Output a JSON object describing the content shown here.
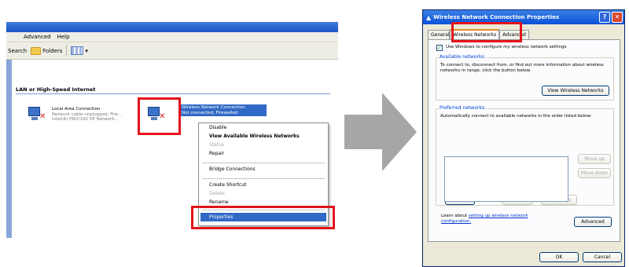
{
  "left_window": {
    "menu": [
      "Advanced",
      "Help"
    ],
    "toolbar": {
      "search": "Search",
      "folders": "Folders",
      "views_caret": "▾"
    },
    "group_header": "LAN or High-Speed Internet",
    "lan": {
      "name": "Local Area Connection",
      "status": "Network cable unplugged, Fire...",
      "device": "Intel(R) PRO/100 VE Network..."
    },
    "wireless": {
      "name": "Wireless Network Connection",
      "status": "Not connected, Firewalled",
      "device": ""
    }
  },
  "context_menu": {
    "items": [
      {
        "label": "Disable",
        "style": ""
      },
      {
        "label": "View Available Wireless Networks",
        "style": "bold"
      },
      {
        "label": "Status",
        "style": "disabled"
      },
      {
        "label": "Repair",
        "style": ""
      },
      {
        "label": "Bridge Connections",
        "style": ""
      },
      {
        "label": "Create Shortcut",
        "style": ""
      },
      {
        "label": "Delete",
        "style": "disabled"
      },
      {
        "label": "Rename",
        "style": ""
      }
    ],
    "selected": "Properties"
  },
  "dialog": {
    "title": "Wireless Network Connection Properties",
    "help": "?",
    "close": "✕",
    "tabs": [
      "General",
      "Wireless Networks",
      "Advanced"
    ],
    "use_windows_label": "Use Windows to configure my wireless network settings",
    "available": {
      "title": "Available networks:",
      "text": "To connect to, disconnect from, or find out more information about wireless networks in range, click the button below.",
      "button": "View Wireless Networks"
    },
    "preferred": {
      "title": "Preferred networks:",
      "text": "Automatically connect to available networks in the order listed below:",
      "move_up": "Move up",
      "move_down": "Move down",
      "add": "Add...",
      "remove": "Remove",
      "properties": "Properties"
    },
    "learn_prefix": "Learn about ",
    "learn_link": "setting up wireless network configuration.",
    "advanced_button": "Advanced",
    "ok": "OK",
    "cancel": "Cancel"
  },
  "colors": {
    "highlight": "#e3141a",
    "selection": "#3169c6",
    "arrow": "#a6a6a6"
  }
}
